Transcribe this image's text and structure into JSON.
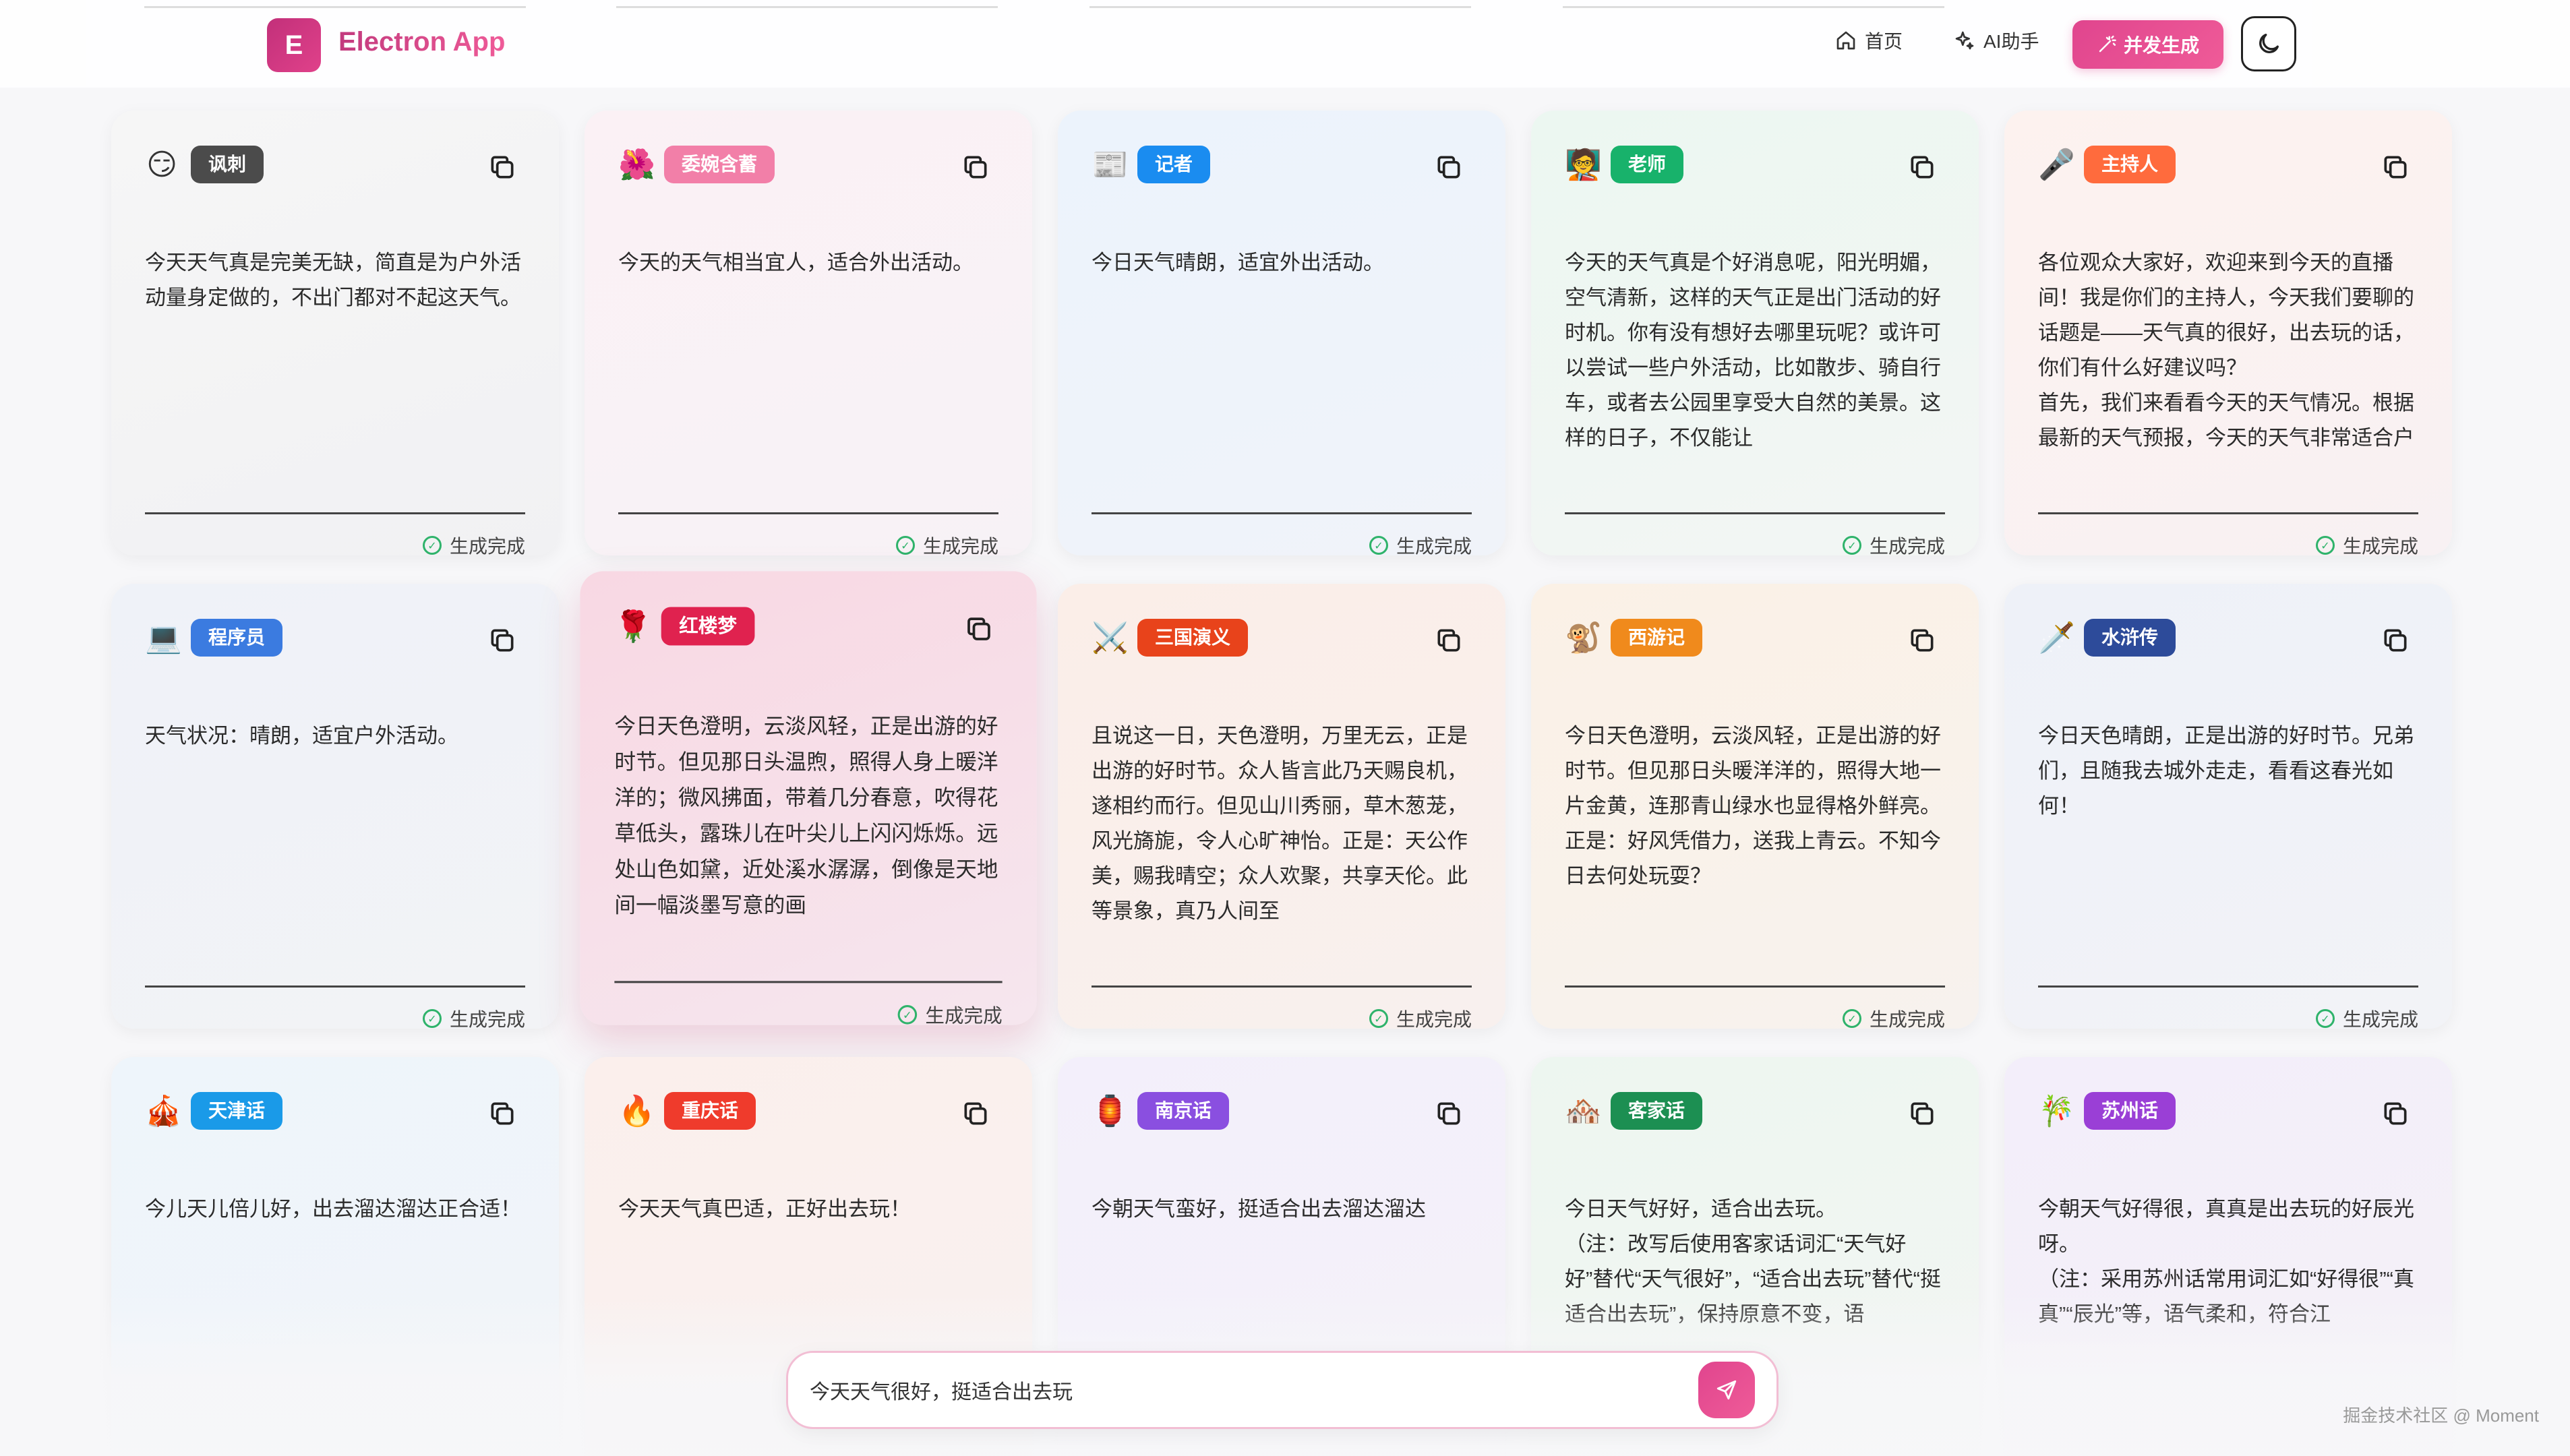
{
  "header": {
    "logo_letter": "E",
    "app_name": "Electron App",
    "nav_home": "首页",
    "nav_ai": "AI助手",
    "nav_generate": "并发生成"
  },
  "status_done": "生成完成",
  "cards": [
    {
      "emoji": "😏",
      "badge": "讽刺",
      "color": "#4b4b4b",
      "bg": "linear-gradient(160deg,#f6f6f6,#f1f1f3)",
      "text": "今天天气真是完美无缺，简直是为户外活动量身定做的，不出门都对不起这天气。"
    },
    {
      "emoji": "🌺",
      "badge": "委婉含蓄",
      "color": "#f27fa8",
      "bg": "linear-gradient(160deg,#fbf1f5,#f7f2f6)",
      "text": "今天的天气相当宜人，适合外出活动。"
    },
    {
      "emoji": "📰",
      "badge": "记者",
      "color": "#1a8cf0",
      "bg": "linear-gradient(160deg,#ecf3fc,#f0f3f9)",
      "text": "今日天气晴朗，适宜外出活动。"
    },
    {
      "emoji": "🧑‍🏫",
      "badge": "老师",
      "color": "#18b26b",
      "bg": "linear-gradient(160deg,#ecf7f1,#f3f6f4)",
      "text": "今天的天气真是个好消息呢，阳光明媚，空气清新，这样的天气正是出门活动的好时机。你有没有想好去哪里玩呢？或许可以尝试一些户外活动，比如散步、骑自行车，或者去公园里享受大自然的美景。这样的日子，不仅能让"
    },
    {
      "emoji": "🎤",
      "badge": "主持人",
      "color": "#ff6b3d",
      "bg": "linear-gradient(160deg,#fdf2ef,#f8f1f3)",
      "text": "各位观众大家好，欢迎来到今天的直播间！我是你们的主持人，今天我们要聊的话题是——天气真的很好，出去玩的话，你们有什么好建议吗？\n首先，我们来看看今天的天气情况。根据最新的天气预报，今天的天气非常适合户"
    },
    {
      "emoji": "💻",
      "badge": "程序员",
      "color": "#3b7be0",
      "bg": "linear-gradient(160deg,#eff2f8,#f2f3f6)",
      "text": "天气状况：晴朗，适宜户外活动。"
    },
    {
      "emoji": "🌹",
      "badge": "红楼梦",
      "color": "#e0224f",
      "bg": "linear-gradient(160deg,#f8d8e3,#f6e6ee)",
      "text": "今日天色澄明，云淡风轻，正是出游的好时节。但见那日头温煦，照得人身上暖洋洋的；微风拂面，带着几分春意，吹得花草低头，露珠儿在叶尖儿上闪闪烁烁。远处山色如黛，近处溪水潺潺，倒像是天地间一幅淡墨写意的画"
    },
    {
      "emoji": "⚔️",
      "badge": "三国演义",
      "color": "#e8431b",
      "bg": "linear-gradient(160deg,#fbeee8,#f8f0ee)",
      "text": "且说这一日，天色澄明，万里无云，正是出游的好时节。众人皆言此乃天赐良机，遂相约而行。但见山川秀丽，草木葱茏，风光旖旎，令人心旷神怡。正是：天公作美，赐我晴空；众人欢聚，共享天伦。此等景象，真乃人间至"
    },
    {
      "emoji": "🐒",
      "badge": "西游记",
      "color": "#f08a1c",
      "bg": "linear-gradient(160deg,#fbf1e6,#f7f2ee)",
      "text": "今日天色澄明，云淡风轻，正是出游的好时节。但见那日头暖洋洋的，照得大地一片金黄，连那青山绿水也显得格外鲜亮。正是：好风凭借力，送我上青云。不知今日去何处玩耍？"
    },
    {
      "emoji": "🗡️",
      "badge": "水浒传",
      "color": "#2d4b9a",
      "bg": "linear-gradient(160deg,#eef1f8,#f2f3f7)",
      "text": "今日天色晴朗，正是出游的好时节。兄弟们，且随我去城外走走，看看这春光如何！"
    },
    {
      "emoji": "🎪",
      "badge": "天津话",
      "color": "#1a9ae8",
      "bg": "linear-gradient(160deg,#eef5fb,#f1f4f8)",
      "text": "今儿天儿倍儿好，出去溜达溜达正合适！"
    },
    {
      "emoji": "🔥",
      "badge": "重庆话",
      "color": "#ef3b2c",
      "bg": "linear-gradient(160deg,#fbefec,#f8f1f0)",
      "text": "今天天气真巴适，正好出去玩！"
    },
    {
      "emoji": "🏮",
      "badge": "南京话",
      "color": "#8a4fe0",
      "bg": "linear-gradient(160deg,#f3effb,#f4f2f8)",
      "text": "今朝天气蛮好，挺适合出去溜达溜达"
    },
    {
      "emoji": "🏘️",
      "badge": "客家话",
      "color": "#1c8f52",
      "bg": "linear-gradient(160deg,#edf6f0,#f3f5f3)",
      "text": "今日天气好好，适合出去玩。\n（注：改写后使用客家话词汇“天气好好”替代“天气很好”，“适合出去玩”替代“挺适合出去玩”，保持原意不变，语"
    },
    {
      "emoji": "🎋",
      "badge": "苏州话",
      "color": "#9a3fd6",
      "bg": "linear-gradient(160deg,#f3eefa,#f4f1f7)",
      "text": "今朝天气好得很，真真是出去玩的好辰光呀。\n（注：采用苏州话常用词汇如“好得很”“真真”“辰光”等，语气柔和，符合江"
    }
  ],
  "input": {
    "value": "今天天气很好，挺适合出去玩"
  },
  "watermark": "掘金技术社区 @ Moment"
}
